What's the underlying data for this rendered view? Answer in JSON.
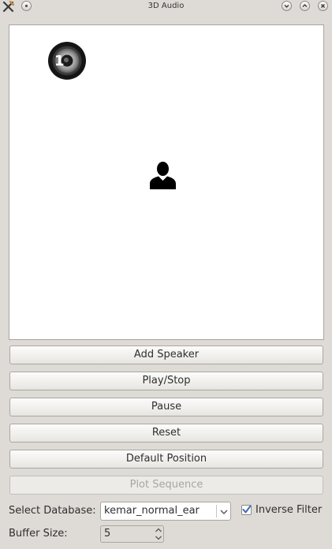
{
  "window": {
    "title": "3D Audio",
    "controls": [
      "minimize-icon",
      "maximize-icon",
      "close-icon"
    ]
  },
  "scene": {
    "speaker_number": "1"
  },
  "buttons": {
    "add_speaker": "Add Speaker",
    "play_stop": "Play/Stop",
    "pause": "Pause",
    "reset": "Reset",
    "default_position": "Default Position",
    "plot_sequence": "Plot Sequence"
  },
  "database": {
    "label": "Select Database:",
    "selected": "kemar_normal_ear"
  },
  "inverse_filter": {
    "label": "Inverse Filter",
    "checked": true
  },
  "buffer": {
    "label": "Buffer Size:",
    "value": "5"
  },
  "colors": {
    "background": "#dedbd6",
    "checkmark": "#3a6fb0"
  }
}
